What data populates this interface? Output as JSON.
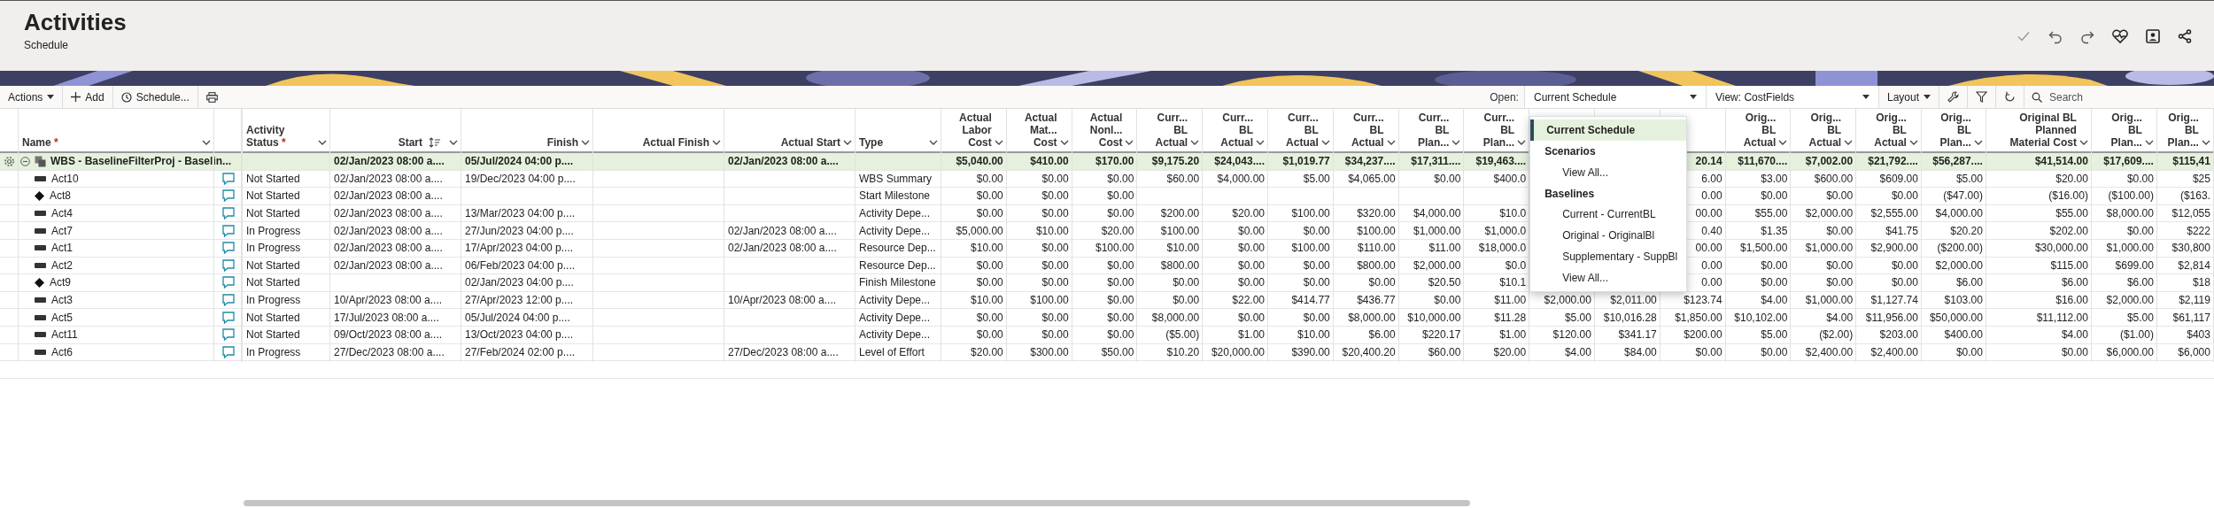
{
  "header": {
    "title": "Activities",
    "subtitle": "Schedule"
  },
  "toolbar": {
    "actions": "Actions",
    "add": "Add",
    "schedule": "Schedule...",
    "open_label": "Open:",
    "open_value": "Current Schedule",
    "view": "View: CostFields",
    "layout": "Layout",
    "search_placeholder": "Search"
  },
  "open_menu": {
    "items": [
      {
        "kind": "option",
        "label": "Current Schedule",
        "selected": true
      },
      {
        "kind": "heading",
        "label": "Scenarios"
      },
      {
        "kind": "option",
        "label": "View All...",
        "selected": false
      },
      {
        "kind": "heading",
        "label": "Baselines"
      },
      {
        "kind": "option",
        "label": "Current - CurrentBL",
        "selected": false
      },
      {
        "kind": "option",
        "label": "Original - OriginalBl",
        "selected": false
      },
      {
        "kind": "option",
        "label": "Supplementary - SuppBl",
        "selected": false
      },
      {
        "kind": "option",
        "label": "View All...",
        "selected": false
      }
    ]
  },
  "table": {
    "name_column": {
      "lines": [
        "Name"
      ],
      "required_mark": "*"
    },
    "columns": [
      {
        "kind": "text",
        "lines": [
          "Activity",
          "Status"
        ],
        "required_mark": "*"
      },
      {
        "kind": "date",
        "lines": [
          "Start"
        ],
        "sorted": true
      },
      {
        "kind": "date",
        "lines": [
          "Finish"
        ],
        "sorted": false
      },
      {
        "kind": "date",
        "lines": [
          "Actual Finish"
        ],
        "sorted": false
      },
      {
        "kind": "date",
        "lines": [
          "Actual Start"
        ],
        "sorted": false
      },
      {
        "kind": "text",
        "lines": [
          "Type"
        ]
      },
      {
        "kind": "money",
        "lines": [
          "Actual",
          "Labor",
          "Cost"
        ]
      },
      {
        "kind": "money",
        "lines": [
          "Actual",
          "Mat...",
          "Cost"
        ]
      },
      {
        "kind": "money",
        "lines": [
          "Actual",
          "Nonl...",
          "Cost"
        ]
      },
      {
        "kind": "money",
        "lines": [
          "Curr...",
          "BL",
          "Actual"
        ]
      },
      {
        "kind": "money",
        "lines": [
          "Curr...",
          "BL",
          "Actual"
        ]
      },
      {
        "kind": "money",
        "lines": [
          "Curr...",
          "BL",
          "Actual"
        ]
      },
      {
        "kind": "money",
        "lines": [
          "Curr...",
          "BL",
          "Actual"
        ]
      },
      {
        "kind": "money",
        "lines": [
          "Curr...",
          "BL",
          "Plan..."
        ]
      },
      {
        "kind": "money",
        "lines": [
          "Curr...",
          "BL",
          "Plan..."
        ]
      },
      {
        "kind": "money"
      },
      {
        "kind": "money"
      },
      {
        "kind": "money"
      },
      {
        "kind": "money",
        "lines": [
          "Orig...",
          "BL",
          "Actual"
        ]
      },
      {
        "kind": "money",
        "lines": [
          "Orig...",
          "BL",
          "Actual"
        ]
      },
      {
        "kind": "money",
        "lines": [
          "Orig...",
          "BL",
          "Actual"
        ]
      },
      {
        "kind": "money",
        "lines": [
          "Orig...",
          "BL",
          "Plan..."
        ]
      },
      {
        "kind": "money",
        "lines": [
          "Original BL",
          "Planned",
          "Material Cost"
        ]
      },
      {
        "kind": "money",
        "lines": [
          "Orig...",
          "BL",
          "Plan..."
        ]
      },
      {
        "kind": "money",
        "lines": [
          "Orig...",
          "BL",
          "Plan..."
        ]
      }
    ],
    "rows": [
      {
        "kind": "wbs",
        "name": "WBS - BaselineFilterProj - Baselin...",
        "expanded": true,
        "cells": [
          null,
          "02/Jan/2023 08:00 a....",
          "05/Jul/2024 04:00 p....",
          null,
          "02/Jan/2023 08:00 a....",
          null,
          "$5,040.00",
          "$410.00",
          "$170.00",
          "$9,175.20",
          "$24,043....",
          "$1,019.77",
          "$34,237....",
          "$17,311....",
          "$19,463....",
          null,
          null,
          "20.14",
          "$11,670....",
          "$7,002.00",
          "$21,792....",
          "$56,287....",
          "$41,514.00",
          "$17,609....",
          "$115,41"
        ]
      },
      {
        "kind": "task",
        "name": "Act10",
        "cells": [
          "Not Started",
          "02/Jan/2023 08:00 a....",
          "19/Dec/2023 04:00 p....",
          null,
          null,
          "WBS Summary",
          "$0.00",
          "$0.00",
          "$0.00",
          "$60.00",
          "$4,000.00",
          "$5.00",
          "$4,065.00",
          "$0.00",
          "$400.0",
          null,
          null,
          "6.00",
          "$3.00",
          "$600.00",
          "$609.00",
          "$5.00",
          "$20.00",
          "$0.00",
          "$25"
        ]
      },
      {
        "kind": "milestone",
        "name": "Act8",
        "cells": [
          "Not Started",
          "02/Jan/2023 08:00 a....",
          null,
          null,
          null,
          "Start Milestone",
          "$0.00",
          "$0.00",
          "$0.00",
          null,
          null,
          null,
          null,
          null,
          null,
          null,
          null,
          "0.00",
          "$0.00",
          "$0.00",
          "$0.00",
          "($47.00)",
          "($16.00)",
          "($100.00)",
          "($163."
        ]
      },
      {
        "kind": "task",
        "name": "Act4",
        "cells": [
          "Not Started",
          "02/Jan/2023 08:00 a....",
          "13/Mar/2023 04:00 p....",
          null,
          null,
          "Activity Depe...",
          "$0.00",
          "$0.00",
          "$0.00",
          "$200.00",
          "$20.00",
          "$100.00",
          "$320.00",
          "$4,000.00",
          "$10.0",
          null,
          null,
          "00.00",
          "$55.00",
          "$2,000.00",
          "$2,555.00",
          "$4,000.00",
          "$55.00",
          "$8,000.00",
          "$12,055"
        ]
      },
      {
        "kind": "task",
        "name": "Act7",
        "cells": [
          "In Progress",
          "02/Jan/2023 08:00 a....",
          "27/Jun/2023 04:00 p....",
          null,
          "02/Jan/2023 08:00 a....",
          "Activity Depe...",
          "$5,000.00",
          "$10.00",
          "$20.00",
          "$100.00",
          "$0.00",
          "$0.00",
          "$100.00",
          "$1,000.00",
          "$1,000.0",
          null,
          null,
          "0.40",
          "$1.35",
          "$0.00",
          "$41.75",
          "$20.20",
          "$202.00",
          "$0.00",
          "$222"
        ]
      },
      {
        "kind": "task",
        "name": "Act1",
        "cells": [
          "In Progress",
          "02/Jan/2023 08:00 a....",
          "17/Apr/2023 04:00 p....",
          null,
          "02/Jan/2023 08:00 a....",
          "Resource Dep...",
          "$10.00",
          "$0.00",
          "$100.00",
          "$10.00",
          "$0.00",
          "$100.00",
          "$110.00",
          "$11.00",
          "$18,000.0",
          null,
          null,
          "00.00",
          "$1,500.00",
          "$1,000.00",
          "$2,900.00",
          "($200.00)",
          "$30,000.00",
          "$1,000.00",
          "$30,800"
        ]
      },
      {
        "kind": "task",
        "name": "Act2",
        "cells": [
          "Not Started",
          "02/Jan/2023 08:00 a....",
          "06/Feb/2023 04:00 p....",
          null,
          null,
          "Resource Dep...",
          "$0.00",
          "$0.00",
          "$0.00",
          "$800.00",
          "$0.00",
          "$0.00",
          "$800.00",
          "$2,000.00",
          "$0.0",
          null,
          null,
          "0.00",
          "$0.00",
          "$0.00",
          "$0.00",
          "$2,000.00",
          "$115.00",
          "$699.00",
          "$2,814"
        ]
      },
      {
        "kind": "milestone",
        "name": "Act9",
        "cells": [
          "Not Started",
          null,
          "02/Jan/2023 04:00 p....",
          null,
          null,
          "Finish Milestone",
          "$0.00",
          "$0.00",
          "$0.00",
          "$0.00",
          "$0.00",
          "$0.00",
          "$0.00",
          "$20.50",
          "$10.1",
          null,
          null,
          "0.00",
          "$0.00",
          "$0.00",
          "$0.00",
          "$6.00",
          "$6.00",
          "$6.00",
          "$18"
        ]
      },
      {
        "kind": "task",
        "name": "Act3",
        "cells": [
          "In Progress",
          "10/Apr/2023 08:00 a....",
          "27/Apr/2023 12:00 p....",
          null,
          "10/Apr/2023 08:00 a....",
          "Activity Depe...",
          "$10.00",
          "$100.00",
          "$0.00",
          "$0.00",
          "$22.00",
          "$414.77",
          "$436.77",
          "$0.00",
          "$11.00",
          "$2,000.00",
          "$2,011.00",
          "$123.74",
          "$4.00",
          "$1,000.00",
          "$1,127.74",
          "$103.00",
          "$16.00",
          "$2,000.00",
          "$2,119"
        ]
      },
      {
        "kind": "task",
        "name": "Act5",
        "cells": [
          "Not Started",
          "17/Jul/2023 08:00 a....",
          "05/Jul/2024 04:00 p....",
          null,
          null,
          "Activity Depe...",
          "$0.00",
          "$0.00",
          "$0.00",
          "$8,000.00",
          "$0.00",
          "$0.00",
          "$8,000.00",
          "$10,000.00",
          "$11.28",
          "$5.00",
          "$10,016.28",
          "$1,850.00",
          "$10,102.00",
          "$4.00",
          "$11,956.00",
          "$50,000.00",
          "$11,112.00",
          "$5.00",
          "$61,117"
        ]
      },
      {
        "kind": "task",
        "name": "Act11",
        "cells": [
          "Not Started",
          "09/Oct/2023 08:00 a....",
          "13/Oct/2023 04:00 p....",
          null,
          null,
          "Activity Depe...",
          "$0.00",
          "$0.00",
          "$0.00",
          "($5.00)",
          "$1.00",
          "$10.00",
          "$6.00",
          "$220.17",
          "$1.00",
          "$120.00",
          "$341.17",
          "$200.00",
          "$5.00",
          "($2.00)",
          "$203.00",
          "$400.00",
          "$4.00",
          "($1.00)",
          "$403"
        ]
      },
      {
        "kind": "task",
        "name": "Act6",
        "cells": [
          "In Progress",
          "27/Dec/2023 08:00 a....",
          "27/Feb/2024 02:00 p....",
          null,
          "27/Dec/2023 08:00 a....",
          "Level of Effort",
          "$20.00",
          "$300.00",
          "$50.00",
          "$10.20",
          "$20,000.00",
          "$390.00",
          "$20,400.20",
          "$60.00",
          "$20.00",
          "$4.00",
          "$84.00",
          "$0.00",
          "$0.00",
          "$2,400.00",
          "$2,400.00",
          "$0.00",
          "$0.00",
          "$6,000.00",
          "$6,000"
        ]
      }
    ]
  }
}
